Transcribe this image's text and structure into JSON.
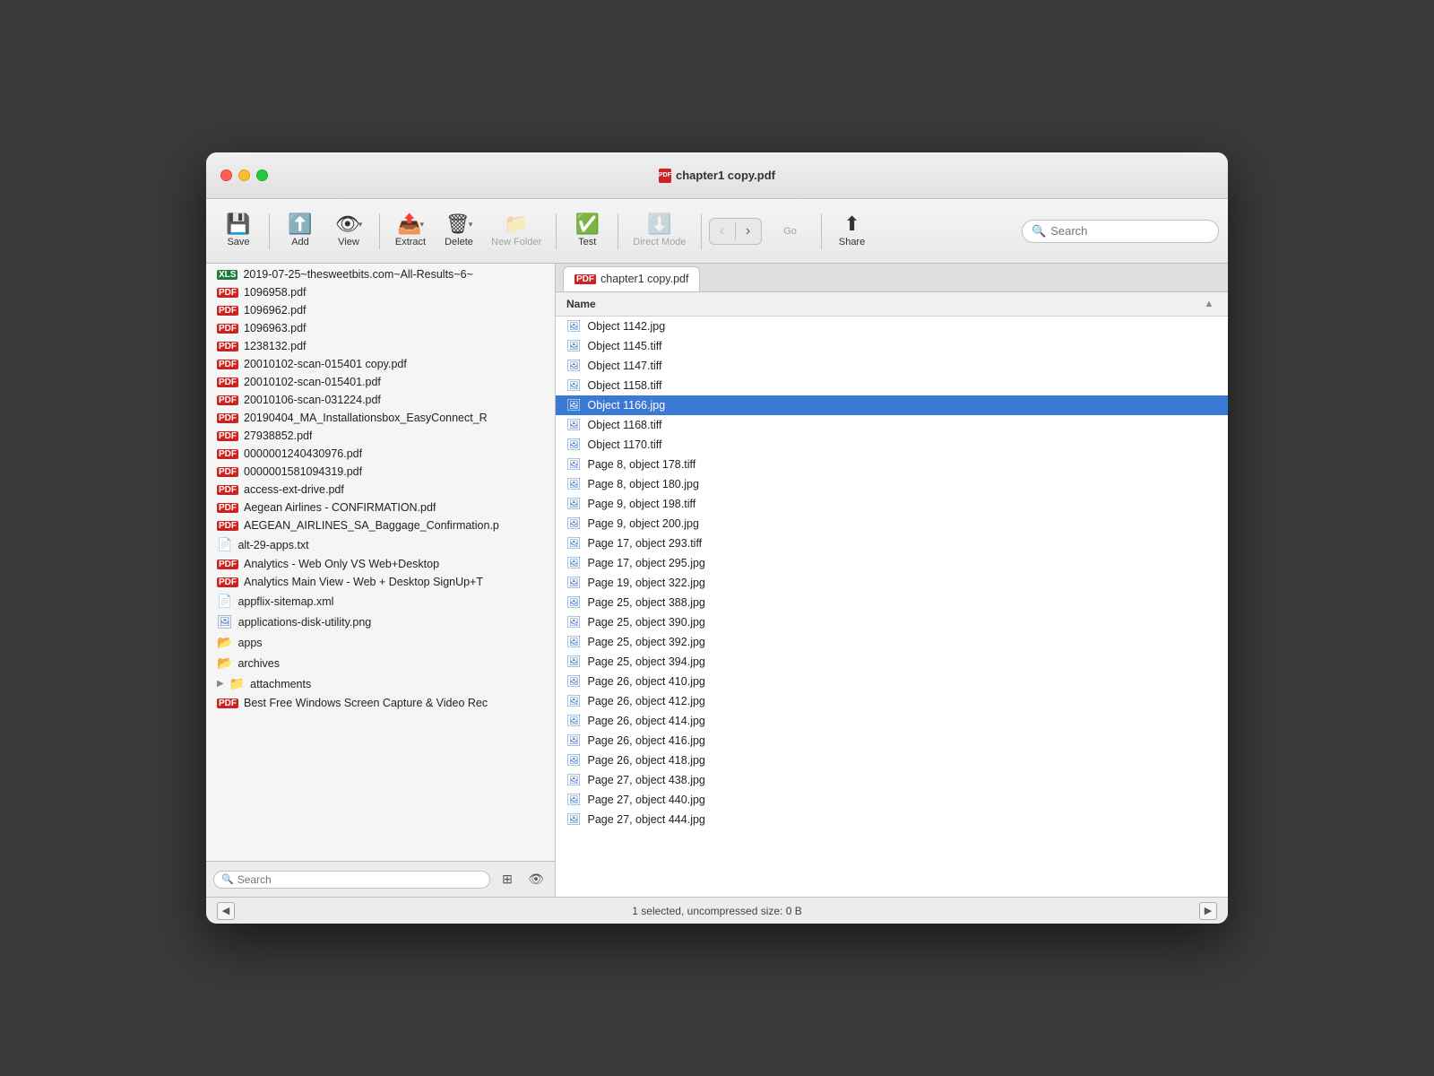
{
  "window": {
    "title": "chapter1 copy.pdf"
  },
  "toolbar": {
    "save_label": "Save",
    "add_label": "Add",
    "view_label": "View",
    "extract_label": "Extract",
    "delete_label": "Delete",
    "new_folder_label": "New Folder",
    "test_label": "Test",
    "direct_mode_label": "Direct Mode",
    "go_label": "Go",
    "share_label": "Share",
    "search_placeholder": "Search"
  },
  "left_panel": {
    "files": [
      {
        "name": "2019-07-25~thesweetbits.com~All-Results~6~",
        "type": "xls"
      },
      {
        "name": "1096958.pdf",
        "type": "pdf"
      },
      {
        "name": "1096962.pdf",
        "type": "pdf"
      },
      {
        "name": "1096963.pdf",
        "type": "pdf"
      },
      {
        "name": "1238132.pdf",
        "type": "pdf"
      },
      {
        "name": "20010102-scan-015401 copy.pdf",
        "type": "pdf"
      },
      {
        "name": "20010102-scan-015401.pdf",
        "type": "pdf"
      },
      {
        "name": "20010106-scan-031224.pdf",
        "type": "pdf"
      },
      {
        "name": "20190404_MA_Installationsbox_EasyConnect_R",
        "type": "pdf"
      },
      {
        "name": "27938852.pdf",
        "type": "pdf"
      },
      {
        "name": "0000001240430976.pdf",
        "type": "pdf"
      },
      {
        "name": "0000001581094319.pdf",
        "type": "pdf"
      },
      {
        "name": "access-ext-drive.pdf",
        "type": "pdf"
      },
      {
        "name": "Aegean Airlines - CONFIRMATION.pdf",
        "type": "pdf"
      },
      {
        "name": "AEGEAN_AIRLINES_SA_Baggage_Confirmation.p",
        "type": "pdf"
      },
      {
        "name": "alt-29-apps.txt",
        "type": "txt"
      },
      {
        "name": "Analytics - Web Only VS Web+Desktop",
        "type": "pdf"
      },
      {
        "name": "Analytics Main View - Web + Desktop SignUp+T",
        "type": "pdf"
      },
      {
        "name": "appflix-sitemap.xml",
        "type": "xml"
      },
      {
        "name": "applications-disk-utility.png",
        "type": "img"
      },
      {
        "name": "apps",
        "type": "folder"
      },
      {
        "name": "archives",
        "type": "folder"
      },
      {
        "name": "attachments",
        "type": "folder_expand"
      },
      {
        "name": "Best Free Windows Screen Capture & Video Rec",
        "type": "pdf"
      }
    ],
    "search_placeholder": "Search"
  },
  "right_panel": {
    "tab_label": "chapter1 copy.pdf",
    "column_header": "Name",
    "items": [
      {
        "name": "Object 1142.jpg",
        "selected": false
      },
      {
        "name": "Object 1145.tiff",
        "selected": false
      },
      {
        "name": "Object 1147.tiff",
        "selected": false
      },
      {
        "name": "Object 1158.tiff",
        "selected": false
      },
      {
        "name": "Object 1166.jpg",
        "selected": true
      },
      {
        "name": "Object 1168.tiff",
        "selected": false
      },
      {
        "name": "Object 1170.tiff",
        "selected": false
      },
      {
        "name": "Page 8, object 178.tiff",
        "selected": false
      },
      {
        "name": "Page 8, object 180.jpg",
        "selected": false
      },
      {
        "name": "Page 9, object 198.tiff",
        "selected": false
      },
      {
        "name": "Page 9, object 200.jpg",
        "selected": false
      },
      {
        "name": "Page 17, object 293.tiff",
        "selected": false
      },
      {
        "name": "Page 17, object 295.jpg",
        "selected": false
      },
      {
        "name": "Page 19, object 322.jpg",
        "selected": false
      },
      {
        "name": "Page 25, object 388.jpg",
        "selected": false
      },
      {
        "name": "Page 25, object 390.jpg",
        "selected": false
      },
      {
        "name": "Page 25, object 392.jpg",
        "selected": false
      },
      {
        "name": "Page 25, object 394.jpg",
        "selected": false
      },
      {
        "name": "Page 26, object 410.jpg",
        "selected": false
      },
      {
        "name": "Page 26, object 412.jpg",
        "selected": false
      },
      {
        "name": "Page 26, object 414.jpg",
        "selected": false
      },
      {
        "name": "Page 26, object 416.jpg",
        "selected": false
      },
      {
        "name": "Page 26, object 418.jpg",
        "selected": false
      },
      {
        "name": "Page 27, object 438.jpg",
        "selected": false
      },
      {
        "name": "Page 27, object 440.jpg",
        "selected": false
      },
      {
        "name": "Page 27, object 444.jpg",
        "selected": false
      }
    ]
  },
  "status_bar": {
    "text": "1 selected, uncompressed size: 0 B"
  }
}
